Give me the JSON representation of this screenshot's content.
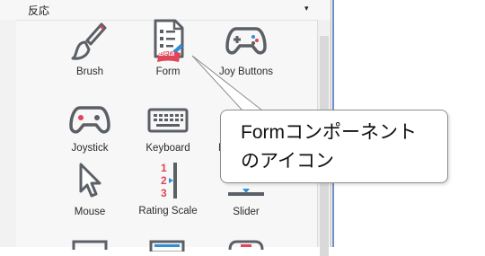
{
  "panel": {
    "title": "反応",
    "caret": "▾"
  },
  "components": [
    {
      "label": "Brush",
      "icon": "brush-icon"
    },
    {
      "label": "Form",
      "icon": "form-icon",
      "badge": "Beta"
    },
    {
      "label": "Joy Buttons",
      "icon": "gamepad-icon"
    },
    {
      "label": "Joystick",
      "icon": "joystick-icon"
    },
    {
      "label": "Keyboard",
      "icon": "keyboard-icon"
    },
    {
      "label": "M",
      "icon": "mic-icon"
    },
    {
      "label": "Mouse",
      "icon": "mouse-pointer-icon"
    },
    {
      "label": "Rating Scale",
      "icon": "rating-scale-icon",
      "scale_numbers": [
        "1",
        "2",
        "3"
      ]
    },
    {
      "label": "Slider",
      "icon": "slider-icon"
    }
  ],
  "callout": {
    "line1": "Formコンポーネント",
    "line2": "のアイコン"
  },
  "colors": {
    "accent_red": "#e0455a",
    "icon_gray": "#5b5f66",
    "accent_blue": "#2f8fd6"
  }
}
